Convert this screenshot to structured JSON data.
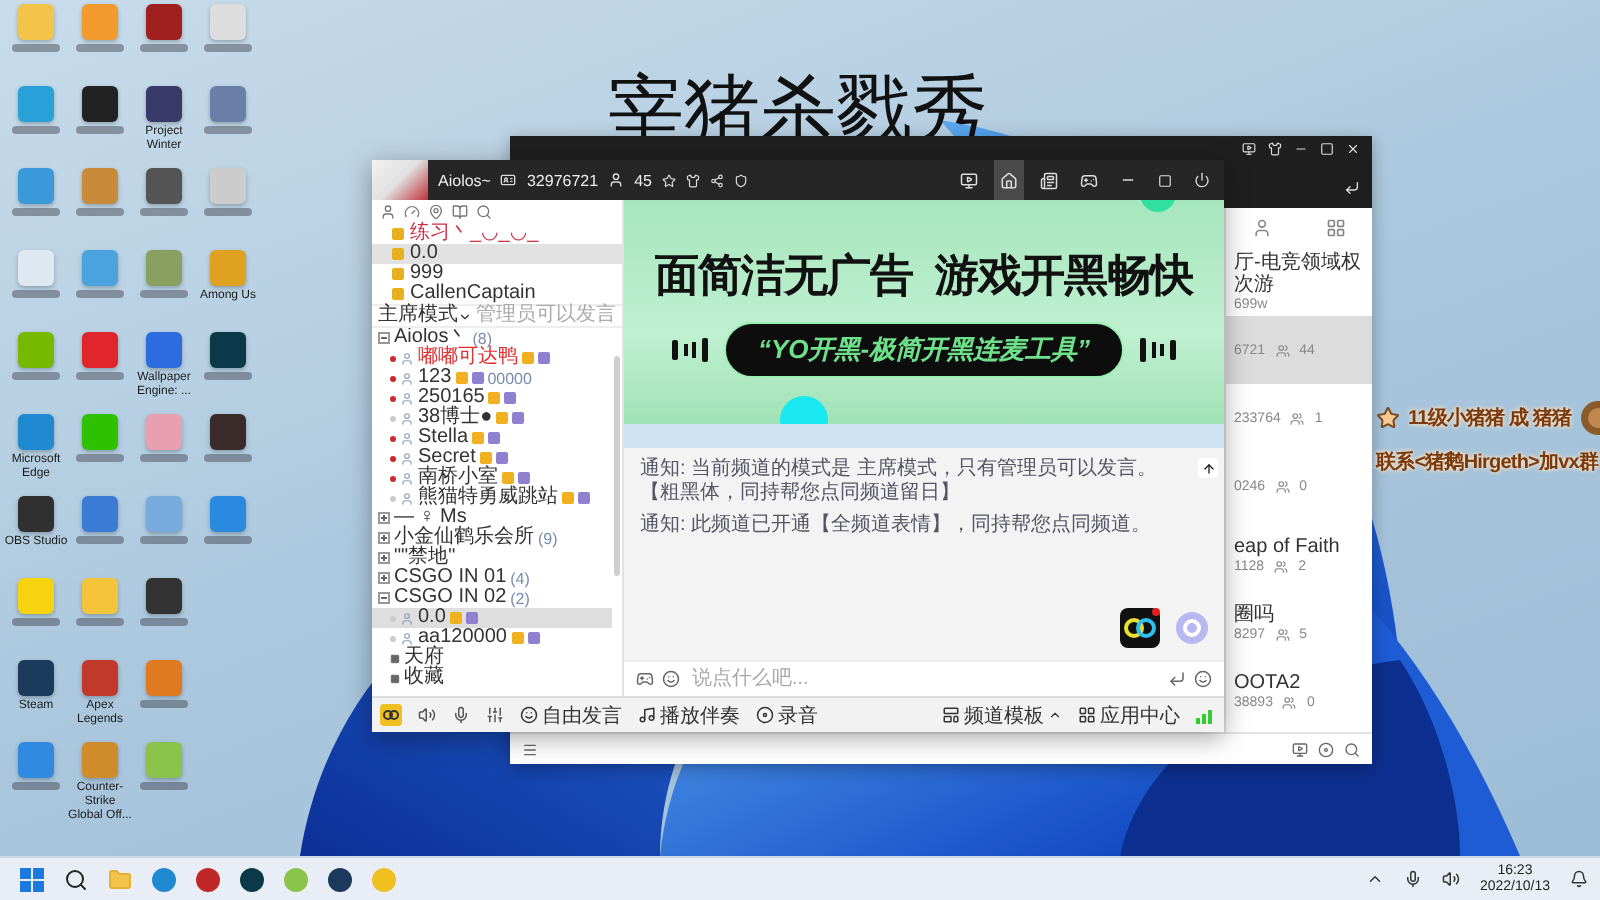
{
  "overlay_title": "宰猪杀戮秀",
  "desktop_icons": [
    {
      "color": "#f3c34a"
    },
    {
      "color": "#2aa0d8"
    },
    {
      "color": "#3a9ad9"
    },
    {
      "color": "#dfe8f0"
    },
    {
      "color": "#76b900"
    },
    {
      "label": "Microsoft Edge",
      "color": "#1f8ad2"
    },
    {
      "label": "OBS Studio",
      "color": "#303030"
    },
    {
      "color": "#f5d40f"
    },
    {
      "label": "Steam",
      "color": "#1b3a5c"
    },
    {
      "color": "#2f8ae0"
    },
    {
      "color": "#f29a2e"
    },
    {
      "color": "#222222"
    },
    {
      "color": "#c98a3a"
    },
    {
      "color": "#4aa3df"
    },
    {
      "color": "#e0262b"
    },
    {
      "color": "#2dc100"
    },
    {
      "color": "#3a7bd5"
    },
    {
      "color": "#f3c33a"
    },
    {
      "label": "Apex Legends",
      "color": "#c0392b"
    },
    {
      "label": "Counter-Strike Global Off...",
      "color": "#d08c2a"
    },
    {
      "color": "#a02020"
    },
    {
      "label": "Project Winter",
      "color": "#3a3a6a"
    },
    {
      "color": "#555555"
    },
    {
      "color": "#8aa060"
    },
    {
      "label": "Wallpaper Engine: ...",
      "color": "#2d6be0"
    },
    {
      "color": "#e8a0b0"
    },
    {
      "color": "#77aadd"
    },
    {
      "color": "#333333"
    },
    {
      "color": "#e07a20"
    },
    {
      "color": "#8bc34a"
    },
    {
      "color": "#dddddd"
    },
    {
      "color": "#6a7fa8"
    },
    {
      "color": "#cccccc"
    },
    {
      "label": "Among Us",
      "color": "#e0a020"
    },
    {
      "color": "#0a3a4a"
    },
    {
      "color": "#3a2a2a"
    },
    {
      "color": "#2a8ae0"
    }
  ],
  "back_window": {
    "rooms": [
      {
        "title": "厅-电竞领域权次游",
        "meta": "699w",
        "selected": false
      },
      {
        "meta": "6721",
        "count": "44",
        "selected": true
      },
      {
        "meta": "233764",
        "count": "1",
        "selected": false
      },
      {
        "meta": "0246",
        "count": "0",
        "selected": false
      },
      {
        "title": "eap of Faith",
        "meta": "1128",
        "count": "2",
        "selected": false
      },
      {
        "title": "圈吗",
        "meta": "8297",
        "count": "5",
        "selected": false
      },
      {
        "title": "OOTA2",
        "meta": "38893",
        "count": "0",
        "selected": false
      }
    ]
  },
  "app": {
    "user": {
      "name": "Aiolos~",
      "id": "32976721",
      "online": "45"
    },
    "channels": [
      {
        "name": "练习丶_◡_◡_",
        "color": "#d0304a",
        "selected": false
      },
      {
        "name": "0.0",
        "color": "#333333",
        "selected": true
      },
      {
        "name": "999",
        "color": "#333333",
        "selected": false
      },
      {
        "name": "CallenCaptain",
        "color": "#333333",
        "selected": false
      }
    ],
    "mode": "主席模式",
    "mode_note": "管理员可以发言",
    "tree": [
      {
        "kind": "channel",
        "name": "Aiolos丶",
        "count": "(8)",
        "expanded": true,
        "children": [
          {
            "kind": "member",
            "name": "嘟嘟可达鸭",
            "color": "#e03030",
            "mic_on": true,
            "selected": false
          },
          {
            "kind": "member",
            "name": "123",
            "extra": "00000",
            "color": "#333333",
            "mic_on": true,
            "selected": false
          },
          {
            "kind": "member",
            "name": "250165",
            "color": "#333333",
            "mic_on": true,
            "selected": false
          },
          {
            "kind": "member",
            "name": "38博士●",
            "color": "#333333",
            "mic_on": false,
            "selected": false
          },
          {
            "kind": "member",
            "name": "Stella",
            "color": "#333333",
            "mic_on": true,
            "selected": false
          },
          {
            "kind": "member",
            "name": "Secret",
            "color": "#333333",
            "mic_on": true,
            "selected": false
          },
          {
            "kind": "member",
            "name": "南桥小室",
            "color": "#333333",
            "mic_on": true,
            "selected": false
          },
          {
            "kind": "member",
            "name": "熊猫特勇威跳站",
            "color": "#333333",
            "mic_on": false,
            "selected": false
          }
        ]
      },
      {
        "kind": "channel",
        "name": "— ♀ Ms",
        "expanded": false
      },
      {
        "kind": "channel",
        "name": "小金仙鹤乐会所",
        "count": "(9)",
        "expanded": false
      },
      {
        "kind": "channel",
        "name": "\"\"禁地\"",
        "expanded": false
      },
      {
        "kind": "channel",
        "name": "CSGO IN 01",
        "count": "(4)",
        "expanded": false
      },
      {
        "kind": "channel",
        "name": "CSGO IN 02",
        "count": "(2)",
        "expanded": true,
        "children": [
          {
            "kind": "member",
            "name": "0.0",
            "color": "#333333",
            "mic_on": false,
            "selected": true
          },
          {
            "kind": "member",
            "name": "aa120000",
            "color": "#333333",
            "mic_on": false,
            "selected": false
          },
          {
            "kind": "room",
            "name": "天府"
          },
          {
            "kind": "room",
            "name": "收藏"
          }
        ]
      }
    ],
    "banner": {
      "headline": "面简洁无广告  游戏开黑畅快",
      "slogan": "“YO开黑-极简开黑连麦工具”"
    },
    "notices": [
      "通知: 当前频道的模式是 主席模式，只有管理员可以发言。【粗黑体，同持帮您点同频道留日】",
      "通知: 此频道已开通【全频道表情】，同持帮您点同频道。"
    ],
    "input": {
      "placeholder": "说点什么吧..."
    },
    "bottom": {
      "talk": "自由发言",
      "music": "播放伴奏",
      "record": "录音",
      "template": "频道模板",
      "apps": "应用中心"
    }
  },
  "promo": {
    "line1": "11级小猪猪 成 猪猪",
    "line2": "联系<猪鹅Hirgeth>加vx群"
  },
  "taskbar": {
    "time": "16:23",
    "date": "2022/10/13"
  }
}
